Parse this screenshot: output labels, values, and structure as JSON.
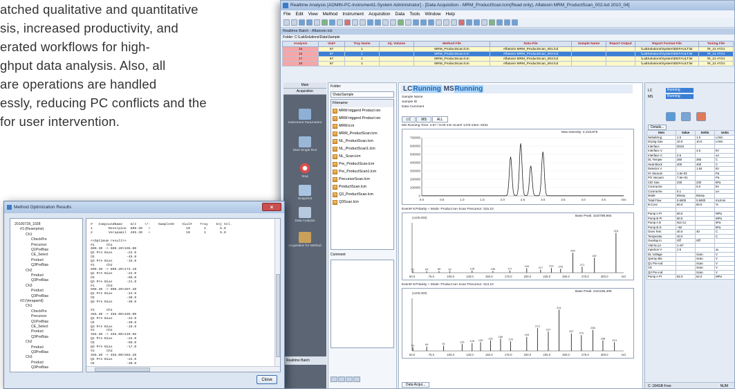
{
  "brochure": {
    "lines": [
      "atched qualitative and quantitative",
      "sis, increased productivity, and",
      "erated workflows for high-",
      "ghput data analysis.  Also, all",
      "are operations are handled",
      "essly, reducing PC conflicts and the",
      "for user intervention."
    ]
  },
  "main_window": {
    "title": "Realtime Analysis [ADMIN-PC-Instrument1-System Administrator] - [Data Acquisition - MRM_ProductScan.lcm(Read only), Aflatoxin MRM_ProductScan_002.lcd  2010_04]",
    "menu": [
      "File",
      "Edit",
      "View",
      "Method",
      "Instrument",
      "Acquisition",
      "Data",
      "Tools",
      "Window",
      "Help"
    ],
    "batch_header": "Realtime Batch - Aflatoxin.lcb",
    "folder_line": "Folder: C:\\LabSolutions\\Data\\Sample",
    "batch_table": {
      "columns": [
        "Analysis",
        "Vial#",
        "Tray Name",
        "Inj. Volume",
        "Method File",
        "Data File",
        "Sample Name",
        "Report Output",
        "Report Format File",
        "Tuning File"
      ],
      "rows": [
        [
          "15",
          "67",
          "1",
          "",
          "MRM_ProductScan.lcm",
          "Aflatoxin MRM_ProductScan_001.lcd",
          "",
          "",
          "\\LabSolutions\\System\\DEFAULT.lsr",
          "\\R_21 AT.lct"
        ],
        [
          "16",
          "67",
          "1",
          "",
          "MRM_ProductScan.lcm",
          "Aflatoxin MRM_ProductScan_002.lcd",
          "",
          "",
          "\\LabSolutions\\System\\DEFAULT.lsr",
          "\\R_21 AT.lct"
        ],
        [
          "17",
          "67",
          "1",
          "",
          "MRM_ProductScan.lcm",
          "Aflatoxin MRM_ProductScan_003.lcd",
          "",
          "",
          "\\LabSolutions\\System\\DEFAULT.lsr",
          "\\R_21 AT.lct"
        ],
        [
          "18",
          "67",
          "1",
          "",
          "MRM_ProductScan.lcm",
          "Aflatoxin MRM_ProductScan_004.lcd",
          "",
          "",
          "\\LabSolutions\\System\\DEFAULT.lsr",
          "\\R_21 AT.lct"
        ]
      ]
    }
  },
  "left_panel": {
    "tabs": [
      "Main",
      "Acquisition"
    ],
    "items": [
      "Instrument Parameters",
      "Start Single Run",
      "Stop",
      "Snapshot",
      "Data Analysis",
      "Acquisition for Method"
    ],
    "bottom": "Realtime Batch"
  },
  "folder_panel": {
    "label": "Folder:",
    "combo": "\\Data\\Sample",
    "header": "Filename",
    "files": [
      "MRM triggerd Product ion",
      "MRM triggerd Product ion",
      "MRM.lcm",
      "MRM_ProductScan.lcm",
      "NL_ProductScan.lcm",
      "NL_ProductScan1.lcm",
      "NL_Scan.lcm",
      "Pre_ProductScan.lcm",
      "Pre_ProductScan1.lcm",
      "PrecursorScan.lcm",
      "ProductScan.lcm",
      "Q3_ProductScan.lcm",
      "Q3Scan.lcm"
    ],
    "comment_label": "Comment"
  },
  "chromatogram": {
    "lc_label": "LC",
    "lc_status": "Running",
    "ms_label": "MS",
    "ms_status": "Running",
    "sample_name": "Sample Name",
    "sample_id": "Sample ID",
    "data_comment": "Data Comment",
    "tabs": [
      "LC",
      "MS",
      "ALL"
    ],
    "run_info": "MS Running Time: 2:57 / 5:00 min  Scan# 1475  Inten: 6331",
    "max_intensity": "Max.Intensity: 4,319,875",
    "event1": "Event# 6:Polarity + Mode: Product Ion Scan Precursor: 315.10",
    "event1_peak": "Base Peak: 315/798,964",
    "event2": "Event# 8:Polarity + Mode: Product Ion Scan Precursor: 313.10",
    "event2_peak": "Base Peak: 241/235,405",
    "bottom_tab": "Data Acqui...",
    "chart_data": [
      {
        "type": "line",
        "x_ticks": [
          "0.0",
          "0.5",
          "1.0",
          "1.5",
          "2.0",
          "2.5",
          "3.0",
          "3.5",
          "4.0",
          "4.5",
          "min"
        ],
        "y_ticks": [
          "700000",
          "600000",
          "500000",
          "400000",
          "300000",
          "200000",
          "100000",
          "0"
        ],
        "peaks": [
          {
            "x": 2.2,
            "y": 470000
          },
          {
            "x": 2.45,
            "y": 630000
          },
          {
            "x": 2.7,
            "y": 360000
          },
          {
            "x": 3.0,
            "y": 530000
          }
        ]
      },
      {
        "type": "bar",
        "xlim": [
          50,
          325
        ],
        "ylim": [
          0,
          1000000
        ],
        "top_label": "(x100,000)",
        "x_ticks": [
          "50.0",
          "75.0",
          "100.0",
          "125.0",
          "150.0",
          "175.0",
          "200.0",
          "225.0",
          "250.0",
          "275.0",
          "300.0",
          "m/z"
        ],
        "bars": [
          {
            "x": 51,
            "y": 30000
          },
          {
            "x": 69,
            "y": 28000
          },
          {
            "x": 85,
            "y": 32000
          },
          {
            "x": 99,
            "y": 30000
          },
          {
            "x": 128,
            "y": 40000
          },
          {
            "x": 155,
            "y": 35000
          },
          {
            "x": 177,
            "y": 45000
          },
          {
            "x": 199,
            "y": 90000
          },
          {
            "x": 217,
            "y": 60000
          },
          {
            "x": 231,
            "y": 95000
          },
          {
            "x": 243,
            "y": 80000
          },
          {
            "x": 259,
            "y": 400000
          },
          {
            "x": 271,
            "y": 120000
          },
          {
            "x": 287,
            "y": 300000
          },
          {
            "x": 315,
            "y": 800000
          }
        ],
        "labels": [
          "51",
          "69",
          "85",
          "99",
          "128",
          "155",
          "177",
          "199",
          "217",
          "231",
          "243",
          "259",
          "271",
          "287",
          "315"
        ]
      },
      {
        "type": "bar",
        "xlim": [
          50,
          325
        ],
        "ylim": [
          0,
          300000
        ],
        "top_label": "(x100,000)",
        "x_ticks": [
          "50.0",
          "75.0",
          "100.0",
          "125.0",
          "150.0",
          "175.0",
          "200.0",
          "225.0",
          "250.0",
          "275.0",
          "300.0",
          "m/z"
        ],
        "bars": [
          {
            "x": 51,
            "y": 20000
          },
          {
            "x": 69,
            "y": 25000
          },
          {
            "x": 91,
            "y": 30000
          },
          {
            "x": 115,
            "y": 40000
          },
          {
            "x": 128,
            "y": 45000
          },
          {
            "x": 139,
            "y": 50000
          },
          {
            "x": 152,
            "y": 60000
          },
          {
            "x": 165,
            "y": 70000
          },
          {
            "x": 178,
            "y": 55000
          },
          {
            "x": 199,
            "y": 80000
          },
          {
            "x": 213,
            "y": 130000
          },
          {
            "x": 227,
            "y": 110000
          },
          {
            "x": 241,
            "y": 235000
          },
          {
            "x": 257,
            "y": 100000
          },
          {
            "x": 270,
            "y": 90000
          },
          {
            "x": 285,
            "y": 120000
          },
          {
            "x": 298,
            "y": 60000
          },
          {
            "x": 313,
            "y": 50000
          }
        ],
        "labels": [
          "51",
          "69",
          "91",
          "115",
          "128",
          "139",
          "152",
          "165",
          "178",
          "199",
          "213",
          "227",
          "241",
          "257",
          "270",
          "285",
          "298",
          "313"
        ]
      }
    ]
  },
  "right_panel": {
    "lc": "LC",
    "lc_status": "Running",
    "ms": "MS",
    "ms_status": "Running",
    "details": "Details...",
    "param_columns": [
      "Item",
      "Value",
      "Settin",
      "Units"
    ],
    "params": [
      [
        "Nebulizing",
        "1.5",
        "1.5",
        "L/min"
      ],
      [
        "Drying Gas",
        "10.0",
        "10.0",
        "L/min"
      ],
      [
        "Interface",
        "DUIS",
        "",
        ""
      ],
      [
        "Interface V",
        "",
        "4.5",
        "kV"
      ],
      [
        "Interface C",
        "2.5",
        "",
        "uA"
      ],
      [
        "DL Temper",
        "250",
        "250",
        "C"
      ],
      [
        "Heat Block",
        "400",
        "400",
        "C"
      ],
      [
        "Detector V",
        "",
        "1.94",
        "kV"
      ],
      [
        "IG Vacuum",
        "1.5e-03",
        "",
        "Pa"
      ],
      [
        "PG Vacuum",
        "7.5e+01",
        "",
        "Pa"
      ],
      [
        "CID Gas",
        "230",
        "230",
        "kPa"
      ],
      [
        "Corona Ne",
        "",
        "0.0",
        "kV"
      ],
      [
        "Corona Ne",
        "0.1",
        "",
        "uA"
      ],
      [
        "Mode",
        "Binary",
        "Binary",
        ""
      ],
      [
        "Total Flow",
        "0.6000",
        "0.6000",
        "mL/min"
      ],
      [
        "B.Conc",
        "60.0",
        "60.0",
        "%"
      ],
      [
        "",
        "",
        "",
        ""
      ],
      [
        "Pump A Pr",
        "50.5",
        "",
        "MPa"
      ],
      [
        "Pump B Pr",
        "50.5",
        "",
        "MPa"
      ],
      [
        "Pump A D",
        "Not Co",
        "",
        "kPa"
      ],
      [
        "Pump B D",
        "~92",
        "",
        "kPa"
      ],
      [
        "Oven Tem",
        "40.0",
        "40",
        "C"
      ],
      [
        "Temperatu",
        "40.0",
        "",
        "C"
      ],
      [
        "Overlap In",
        "Off",
        "Off",
        ""
      ],
      [
        "Vial No.(A",
        "1~67",
        "",
        ""
      ],
      [
        "Injection V",
        "1.5",
        "",
        "uL"
      ],
      [
        "DL Voltage",
        "",
        "Scan",
        "V"
      ],
      [
        "Qarray Bia",
        "",
        "Scan",
        "V"
      ],
      [
        "Q1 Pre-rod",
        "",
        "Scan",
        "V"
      ],
      [
        "CE",
        "",
        "Scan",
        "V"
      ],
      [
        "Q3 Pre-rod",
        "",
        "Scan",
        "V"
      ],
      [
        "Pump A Pr",
        "62.0",
        "62.0",
        "MPa"
      ]
    ],
    "status_disk": "C: 184GB Free",
    "status_num": "NUM"
  },
  "dialog": {
    "title": "Method Optimization Results",
    "tree": [
      {
        "t": "20100728_1028",
        "lv": 0
      },
      {
        "t": "#1:(Reserpine)",
        "lv": 1
      },
      {
        "t": "Ch1",
        "lv": 2
      },
      {
        "t": "CheckPre",
        "lv": 3
      },
      {
        "t": "Precursor",
        "lv": 3
      },
      {
        "t": "Q1PreBias",
        "lv": 3
      },
      {
        "t": "CE_Select",
        "lv": 3
      },
      {
        "t": "Product",
        "lv": 3
      },
      {
        "t": "Q3PreBias",
        "lv": 3
      },
      {
        "t": "Ch2",
        "lv": 2
      },
      {
        "t": "Product",
        "lv": 3
      },
      {
        "t": "Q3PreBias",
        "lv": 3
      },
      {
        "t": "Ch3",
        "lv": 2
      },
      {
        "t": "Product",
        "lv": 3
      },
      {
        "t": "Q3PreBias",
        "lv": 3
      },
      {
        "t": "#2:(Verapamil)",
        "lv": 1
      },
      {
        "t": "Ch1",
        "lv": 2
      },
      {
        "t": "CheckPre",
        "lv": 3
      },
      {
        "t": "Precursor",
        "lv": 3
      },
      {
        "t": "Q1PreBias",
        "lv": 3
      },
      {
        "t": "CE_Select",
        "lv": 3
      },
      {
        "t": "Product",
        "lv": 3
      },
      {
        "t": "Q3PreBias",
        "lv": 3
      },
      {
        "t": "Ch2",
        "lv": 2
      },
      {
        "t": "Product",
        "lv": 3
      },
      {
        "t": "Q3PreBias",
        "lv": 3
      },
      {
        "t": "Ch3",
        "lv": 2
      },
      {
        "t": "Product",
        "lv": 3
      },
      {
        "t": "Q3PreBias",
        "lv": 3
      }
    ],
    "results": [
      "#   CompoundName    m/z    +/-    SampleID    Vial#    Tray    Inj Vol.",
      "1        Reserpine  609.30   +                  10       1       5.0",
      "2        Verapamil  455.30   +                  10       1       5.0",
      "",
      "<<Optimum result>>",
      "#1      Ch1",
      "609.30 -> 609.20>195.00",
      "Q1 Pre Bias       -22.0",
      "CE                -45.0",
      "Q3 Pre Bias       -15.0",
      "#1      Ch2",
      "609.30 -> 609.20>174.10",
      "Q1 Pre Bias       -22.0",
      "CE                -60.0",
      "Q3 Pre Bias       -21.0",
      "#1      Ch3",
      "609.30 -> 609.20>397.20",
      "Q1 Pre Bias       -22.0",
      "CE                -30.0",
      "Q3 Pre Bias       -30.0",
      "",
      "#2      Ch1",
      "455.30 -> 455.00>165.00",
      "Q1 Pre Bias       -22.0",
      "CE                -30.0",
      "Q3 Pre Bias       -19.0",
      "#2      Ch2",
      "455.30 -> 455.00>149.95",
      "Q1 Pre Bias       -22.0",
      "CE                -50.0",
      "Q3 Pre Bias       -17.0",
      "#2      Ch3",
      "455.30 -> 455.00>303.20",
      "Q1 Pre Bias       -22.0",
      "CE                -30.0"
    ],
    "close_label": "Close"
  }
}
